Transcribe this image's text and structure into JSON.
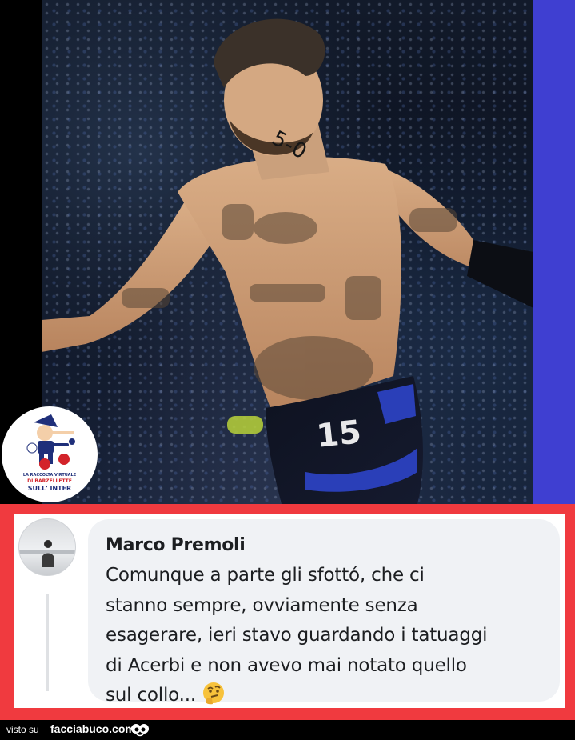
{
  "photo": {
    "neck_tattoo": "5-0",
    "shorts_number": "15"
  },
  "logo": {
    "line1": "LA RACCOLTA VIRTUALE",
    "line2": "DI BARZELLETTE",
    "line3": "SULL' INTER"
  },
  "comment": {
    "author": "Marco Premoli",
    "text": "Comunque a parte gli sfottó, che ci\nstanno sempre, ovviamente senza\nesagerare, ieri stavo guardando i tatuaggi\ndi Acerbi e non avevo mai notato quello\nsul collo...",
    "emoji": "thinking-face"
  },
  "footer": {
    "visto_su": "visto su",
    "site": "facciabuco.com"
  },
  "colors": {
    "frame_red": "#f03a3f",
    "bubble_gray": "#f0f2f5",
    "blue_strip": "#3f3fd1"
  }
}
